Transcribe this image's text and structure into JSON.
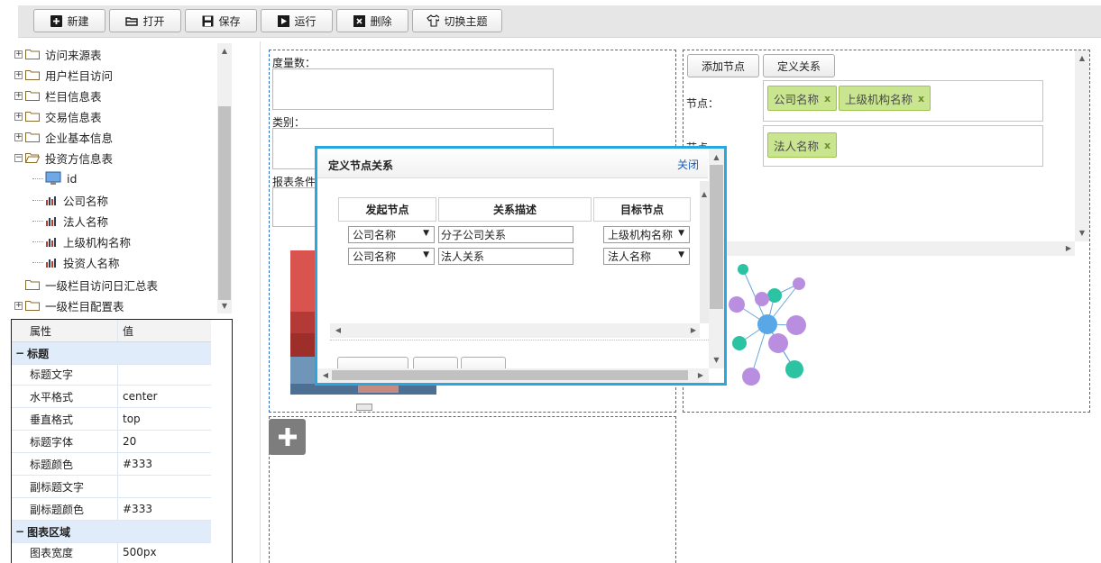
{
  "toolbar": {
    "new_label": "新建",
    "open_label": "打开",
    "save_label": "保存",
    "run_label": "运行",
    "delete_label": "删除",
    "theme_label": "切换主题"
  },
  "tree": {
    "items": [
      {
        "label": "访问来源表"
      },
      {
        "label": "用户栏目访问"
      },
      {
        "label": "栏目信息表"
      },
      {
        "label": "交易信息表"
      },
      {
        "label": "企业基本信息"
      },
      {
        "label": "投资方信息表"
      },
      {
        "label": "id"
      },
      {
        "label": "公司名称"
      },
      {
        "label": "法人名称"
      },
      {
        "label": "上级机构名称"
      },
      {
        "label": "投资人名称"
      },
      {
        "label": "一级栏目访问日汇总表"
      },
      {
        "label": "一级栏目配置表"
      }
    ]
  },
  "props": {
    "col_name": "属性",
    "col_value": "值",
    "group_title": "标题",
    "group_chart": "图表区域",
    "rows": [
      {
        "k": "标题文字",
        "v": ""
      },
      {
        "k": "水平格式",
        "v": "center"
      },
      {
        "k": "垂直格式",
        "v": "top"
      },
      {
        "k": "标题字体",
        "v": "20"
      },
      {
        "k": "标题颜色",
        "v": "#333"
      },
      {
        "k": "副标题文字",
        "v": ""
      },
      {
        "k": "副标题颜色",
        "v": "#333"
      }
    ],
    "chart_rows": [
      {
        "k": "图表宽度",
        "v": "500px"
      }
    ]
  },
  "left_panel": {
    "measure_label": "度量数：",
    "category_label": "类别：",
    "filter_label": "报表条件"
  },
  "right_panel": {
    "add_node_label": "添加节点",
    "define_relation_label": "定义关系",
    "nodes_label": "节点：",
    "relations_label": "节点",
    "node_tags": [
      "公司名称",
      "上级机构名称"
    ],
    "relation_tags": [
      "法人名称"
    ],
    "tag_close": "x"
  },
  "modal": {
    "title": "定义节点关系",
    "close_label": "关闭",
    "headers": [
      "发起节点",
      "关系描述",
      "目标节点"
    ],
    "rows": [
      {
        "source": "公司名称",
        "desc": "分子公司关系",
        "target": "上级机构名称"
      },
      {
        "source": "公司名称",
        "desc": "法人关系",
        "target": "法人名称"
      }
    ]
  },
  "colors": {
    "modal_border": "#29a8e0",
    "tag_bg": "#c9e58f",
    "node_teal": "#2cc3a3",
    "node_purple": "#b98ee0",
    "node_blue": "#5aa7e8"
  }
}
